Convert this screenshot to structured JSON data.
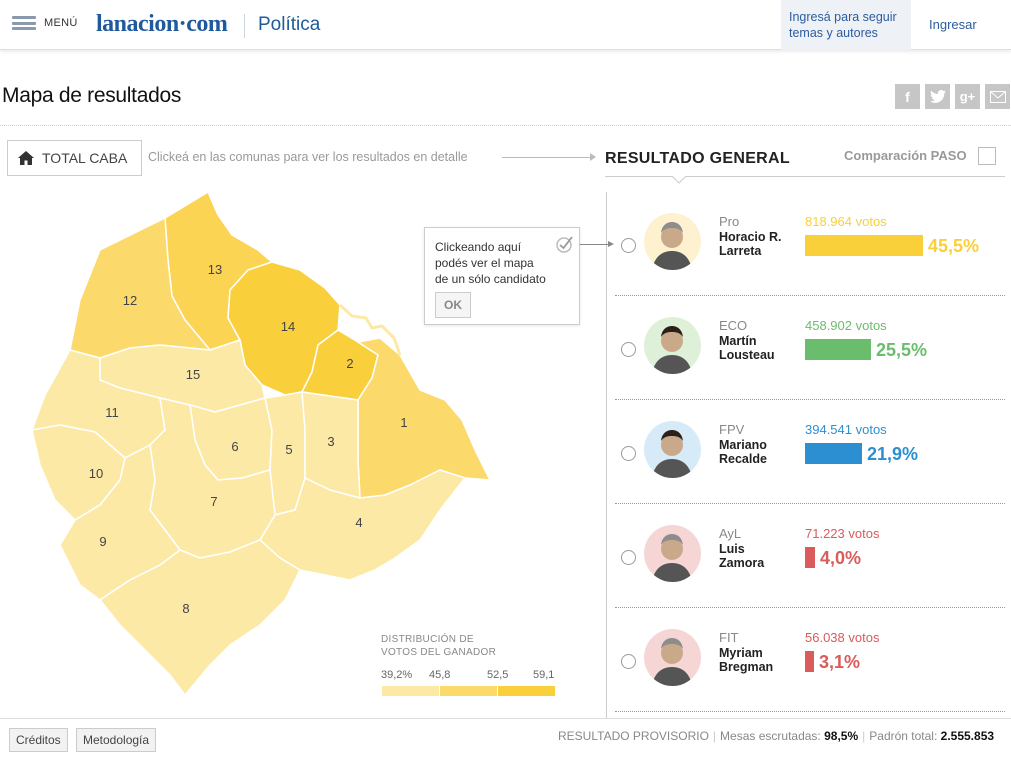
{
  "header": {
    "menu_label": "MENÚ",
    "logo_text": "lanacion·com",
    "section": "Política",
    "follow_text": "Ingresá para seguir temas y autores",
    "login_label": "Ingresar"
  },
  "page": {
    "title": "Mapa de resultados",
    "share_icons": [
      "facebook-icon",
      "twitter-icon",
      "google-plus-icon",
      "email-icon"
    ]
  },
  "map": {
    "total_button": "TOTAL CABA",
    "hint": "Clickeá en las comunas para ver los resultados en detalle",
    "comunas": [
      "1",
      "2",
      "3",
      "4",
      "5",
      "6",
      "7",
      "8",
      "9",
      "10",
      "11",
      "12",
      "13",
      "14",
      "15"
    ],
    "tooltip": {
      "line1": "Clickeando aquí",
      "line2": "podés ver el mapa",
      "line3": "de un sólo candidato",
      "ok": "OK"
    },
    "legend": {
      "title_line1": "DISTRIBUCIÓN DE",
      "title_line2": "VOTOS DEL GANADOR",
      "values": [
        "39,2%",
        "45,8",
        "52,5",
        "59,1"
      ],
      "colors": [
        "#fde9a6",
        "#fbd96a",
        "#f9cf3c"
      ]
    }
  },
  "results": {
    "title": "RESULTADO GENERAL",
    "paso_label": "Comparación PASO",
    "candidates": [
      {
        "party": "Pro",
        "name_line1": "Horacio R.",
        "name_line2": "Larreta",
        "votes": "818.964 votos",
        "pct": "45,5%",
        "share": 45.5,
        "color": "#f9d03a"
      },
      {
        "party": "ECO",
        "name_line1": "Martín",
        "name_line2": "Lousteau",
        "votes": "458.902 votos",
        "pct": "25,5%",
        "share": 25.5,
        "color": "#6bbd6e"
      },
      {
        "party": "FPV",
        "name_line1": "Mariano",
        "name_line2": "Recalde",
        "votes": "394.541 votos",
        "pct": "21,9%",
        "share": 21.9,
        "color": "#2c8fd1"
      },
      {
        "party": "AyL",
        "name_line1": "Luis",
        "name_line2": "Zamora",
        "votes": "71.223 votos",
        "pct": "4,0%",
        "share": 4.0,
        "color": "#d95b5b"
      },
      {
        "party": "FIT",
        "name_line1": "Myriam",
        "name_line2": "Bregman",
        "votes": "56.038 votos",
        "pct": "3,1%",
        "share": 3.1,
        "color": "#d95b5b"
      }
    ]
  },
  "footer": {
    "credits": "Créditos",
    "methodology": "Metodología",
    "provisional": "RESULTADO PROVISORIO",
    "tables_label": "Mesas escrutadas:",
    "tables_value": "98,5%",
    "padron_label": "Padrón total:",
    "padron_value": "2.555.853"
  }
}
